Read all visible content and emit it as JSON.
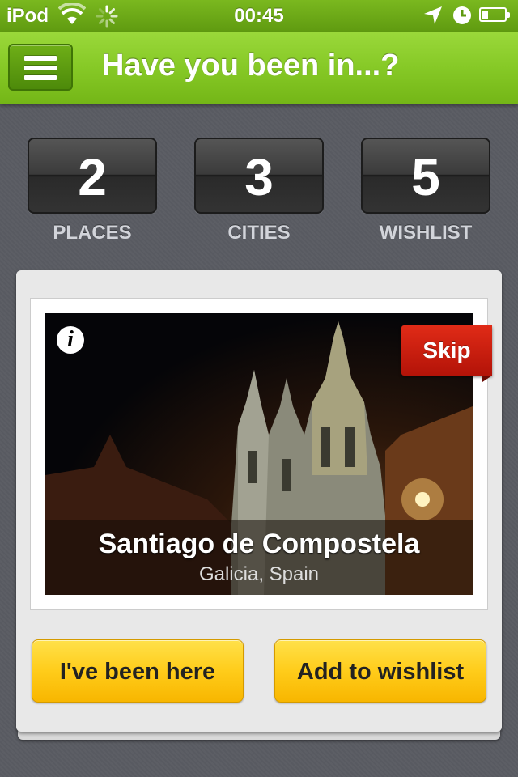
{
  "status_bar": {
    "carrier": "iPod",
    "time": "00:45",
    "battery_level": 0.25
  },
  "nav": {
    "title": "Have you been in...?",
    "menu_icon": "hamburger-menu-icon"
  },
  "counters": [
    {
      "value": "2",
      "label": "PLACES"
    },
    {
      "value": "3",
      "label": "CITIES"
    },
    {
      "value": "5",
      "label": "WISHLIST"
    }
  ],
  "card": {
    "city": "Santiago de Compostela",
    "region": "Galicia, Spain",
    "skip_label": "Skip",
    "info_glyph": "i",
    "photo_subject": "cathedral-night-photo"
  },
  "actions": {
    "been_here_label": "I've been here",
    "wishlist_label": "Add to wishlist"
  },
  "colors": {
    "brand_green": "#86c926",
    "skip_red": "#c81d0e",
    "button_yellow": "#ffcc1a"
  }
}
